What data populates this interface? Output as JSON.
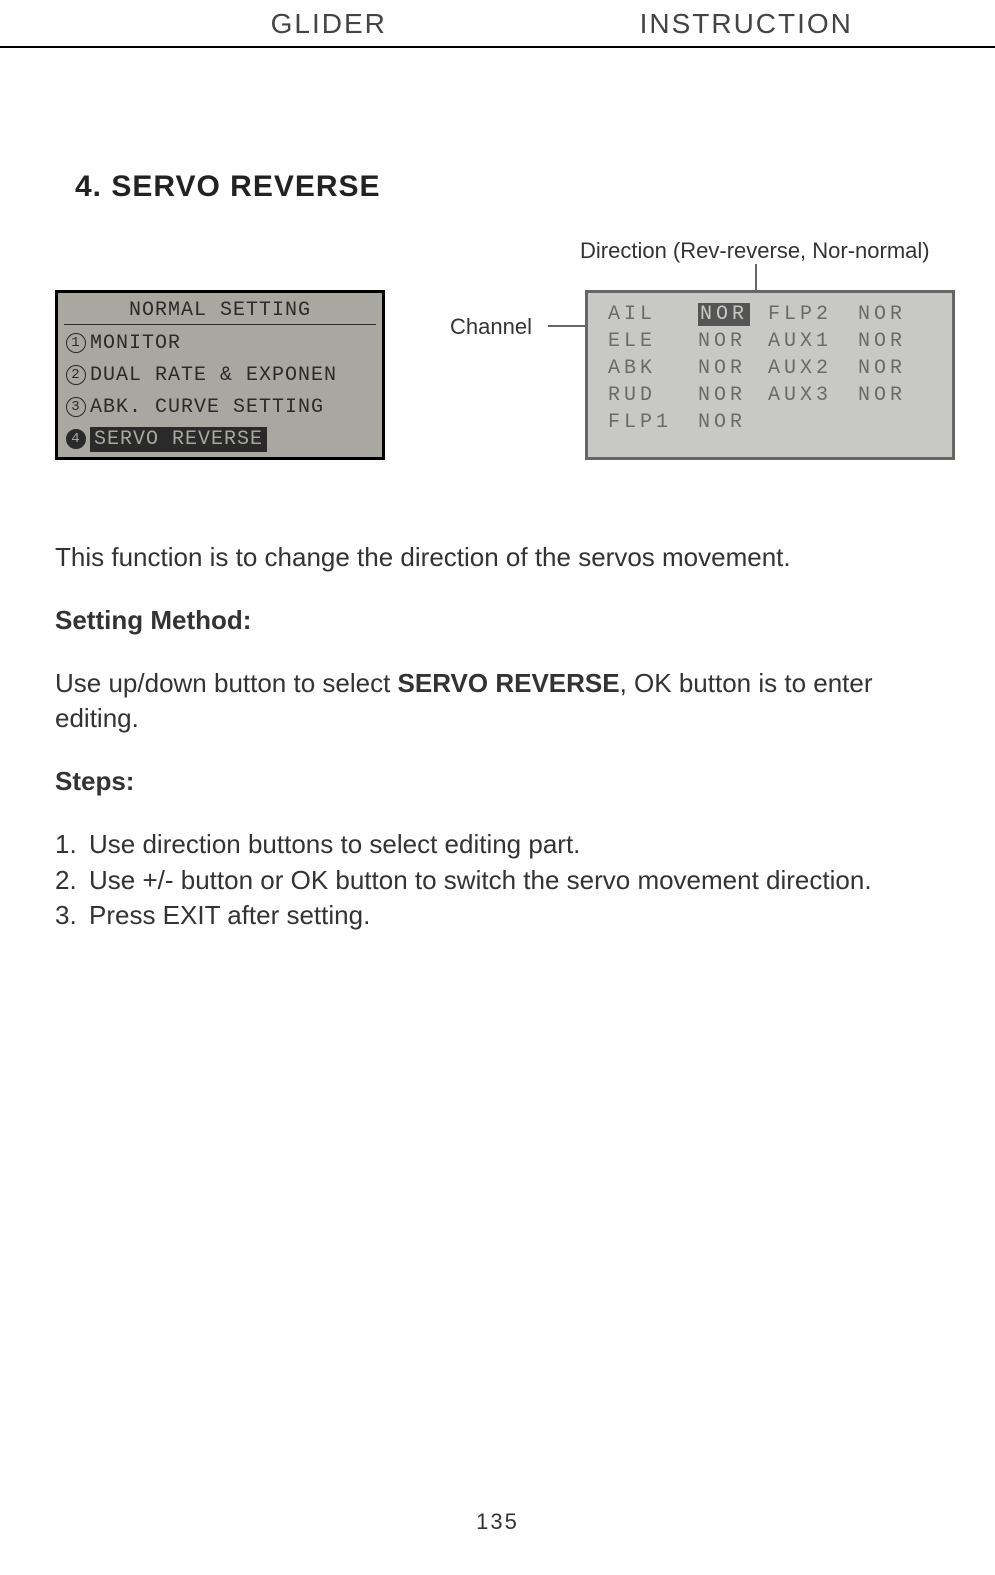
{
  "header": {
    "left": "GLIDER",
    "right": "INSTRUCTION"
  },
  "section_title": "4. SERVO REVERSE",
  "annotations": {
    "direction": "Direction (Rev-reverse, Nor-normal)",
    "channel": "Channel"
  },
  "lcd_left": {
    "title": "NORMAL SETTING",
    "items": [
      {
        "n": "1",
        "label": "MONITOR",
        "selected": false
      },
      {
        "n": "2",
        "label": "DUAL RATE & EXPONEN",
        "selected": false
      },
      {
        "n": "3",
        "label": "ABK. CURVE SETTING",
        "selected": false
      },
      {
        "n": "4",
        "label": "SERVO REVERSE",
        "selected": true
      }
    ]
  },
  "lcd_right": {
    "rows": [
      {
        "ch": "AIL",
        "dir": "NOR",
        "dir_selected": true,
        "ch2": "FLP2",
        "dir2": "NOR"
      },
      {
        "ch": "ELE",
        "dir": "NOR",
        "dir_selected": false,
        "ch2": "AUX1",
        "dir2": "NOR"
      },
      {
        "ch": "ABK",
        "dir": "NOR",
        "dir_selected": false,
        "ch2": "AUX2",
        "dir2": "NOR"
      },
      {
        "ch": "RUD",
        "dir": "NOR",
        "dir_selected": false,
        "ch2": "AUX3",
        "dir2": "NOR"
      },
      {
        "ch": "FLP1",
        "dir": "NOR",
        "dir_selected": false,
        "ch2": "",
        "dir2": ""
      }
    ]
  },
  "intro": "This function is to change the direction of the servos movement.",
  "method_heading": "Setting Method:",
  "method_text_pre": "Use up/down button to select ",
  "method_text_bold": "SERVO REVERSE",
  "method_text_post": ", OK button is to enter editing.",
  "steps_heading": "Steps:",
  "steps": [
    "Use direction buttons to select editing part.",
    "Use +/- button or OK button to switch the servo movement direction.",
    "Press EXIT after setting."
  ],
  "page_number": "135"
}
